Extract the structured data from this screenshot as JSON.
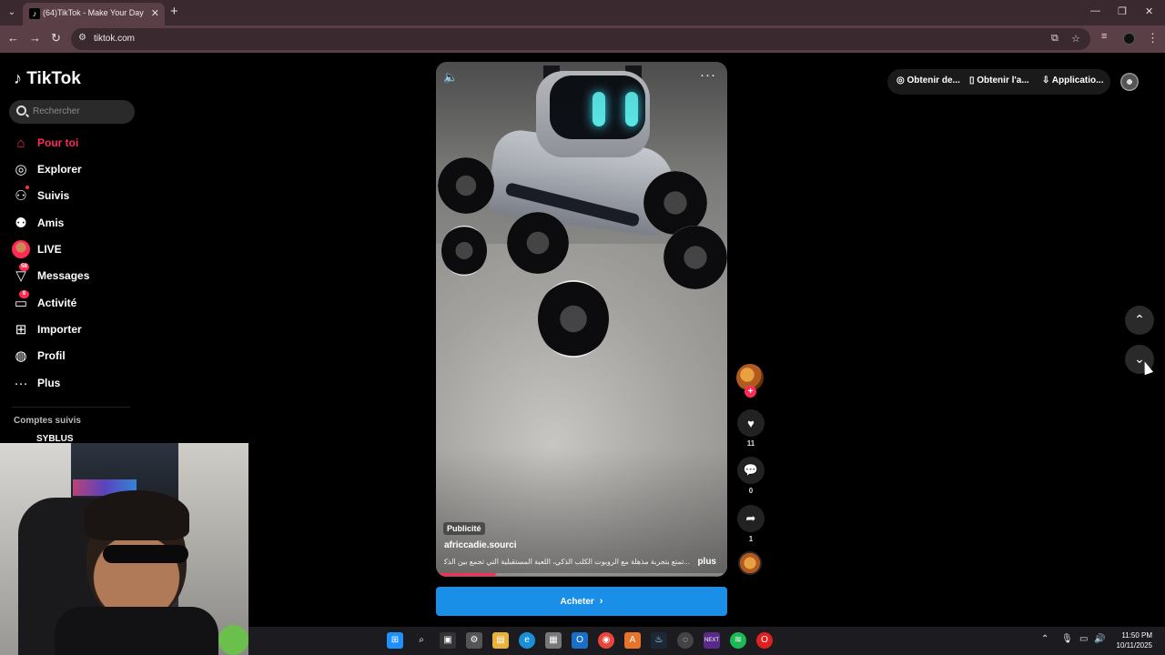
{
  "browser": {
    "tab_title": "(64)TikTok - Make Your Day",
    "url": "tiktok.com"
  },
  "sidebar": {
    "logo": "TikTok",
    "search_placeholder": "Rechercher",
    "items": [
      {
        "label": "Pour toi",
        "icon": "home-icon",
        "active": true
      },
      {
        "label": "Explorer",
        "icon": "compass-icon"
      },
      {
        "label": "Suivis",
        "icon": "following-icon"
      },
      {
        "label": "Amis",
        "icon": "friends-icon"
      },
      {
        "label": "LIVE",
        "icon": "live-icon"
      },
      {
        "label": "Messages",
        "icon": "messages-icon",
        "badge": "58"
      },
      {
        "label": "Activité",
        "icon": "activity-icon",
        "badge": "6"
      },
      {
        "label": "Importer",
        "icon": "upload-icon"
      },
      {
        "label": "Profil",
        "icon": "profile-icon"
      },
      {
        "label": "Plus",
        "icon": "more-icon"
      }
    ],
    "followed_title": "Comptes suivis",
    "followed_accounts": [
      "SYBLUS"
    ]
  },
  "header": {
    "buttons": [
      "Obtenir de...",
      "Obtenir l'a...",
      "Applicatio..."
    ]
  },
  "video": {
    "ad_label": "Publicité",
    "author": "africcadie.sourci",
    "caption": "...تمتع بتجربة مذهلة مع الروبوت الكلب الذكي، اللعبة المستقبلية التي تجمع بين الذكاء، المرح،",
    "more_label": "plus",
    "progress": 0.2
  },
  "actions": {
    "likes": "11",
    "comments": "0",
    "shares": "1"
  },
  "cta_label": "Acheter",
  "taskbar": {
    "time": "11:50 PM",
    "date": "10/11/2025"
  },
  "colors": {
    "accent": "#fe2c55",
    "cta": "#1a8fe8",
    "browser_frame": "#5a4046"
  }
}
